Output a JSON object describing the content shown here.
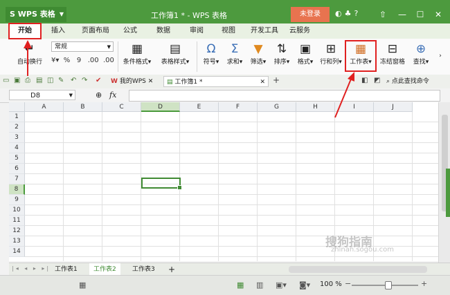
{
  "app": {
    "name": "WPS 表格",
    "doc_title": "工作簿1 * - WPS 表格",
    "login_label": "未登录"
  },
  "menu": {
    "tabs": [
      "开始",
      "插入",
      "页面布局",
      "公式",
      "数据",
      "审阅",
      "视图",
      "开发工具",
      "云服务"
    ],
    "active": "开始"
  },
  "ribbon": {
    "wrap_label": "自动换行",
    "number_format": "常规",
    "percent": "%",
    "comma": "9",
    "dec_inc": ".00",
    "dec_dec": ".00",
    "cond_format": "条件格式",
    "table_style": "表格样式",
    "symbol": "符号",
    "sum": "求和",
    "filter": "筛选",
    "sort": "排序",
    "format": "格式",
    "row_col": "行和列",
    "worksheet": "工作表",
    "freeze": "冻结窗格",
    "find": "查找"
  },
  "quickbar": {
    "tab_mywps": "我的WPS",
    "tab_book": "工作簿1 *",
    "find_cmd": "点此查找命令"
  },
  "formula": {
    "cell_ref": "D8",
    "fx": "fx"
  },
  "grid": {
    "columns": [
      "A",
      "B",
      "C",
      "D",
      "E",
      "F",
      "G",
      "H",
      "I",
      "J"
    ],
    "rows": [
      "1",
      "2",
      "3",
      "4",
      "5",
      "6",
      "7",
      "8",
      "9",
      "10",
      "11",
      "12",
      "13",
      "14"
    ],
    "selected_col": "D",
    "selected_row": "8"
  },
  "sheets": {
    "tabs": [
      "工作表1",
      "工作表2",
      "工作表3"
    ],
    "active": "工作表2",
    "add": "+"
  },
  "status": {
    "zoom": "100 %"
  },
  "watermark": {
    "line1": "搜狗指南",
    "line2": "zhinan.sogou.com"
  },
  "colors": {
    "brand_green": "#4d9a3e",
    "highlight_red": "#e02020",
    "login_orange": "#e8734f"
  }
}
